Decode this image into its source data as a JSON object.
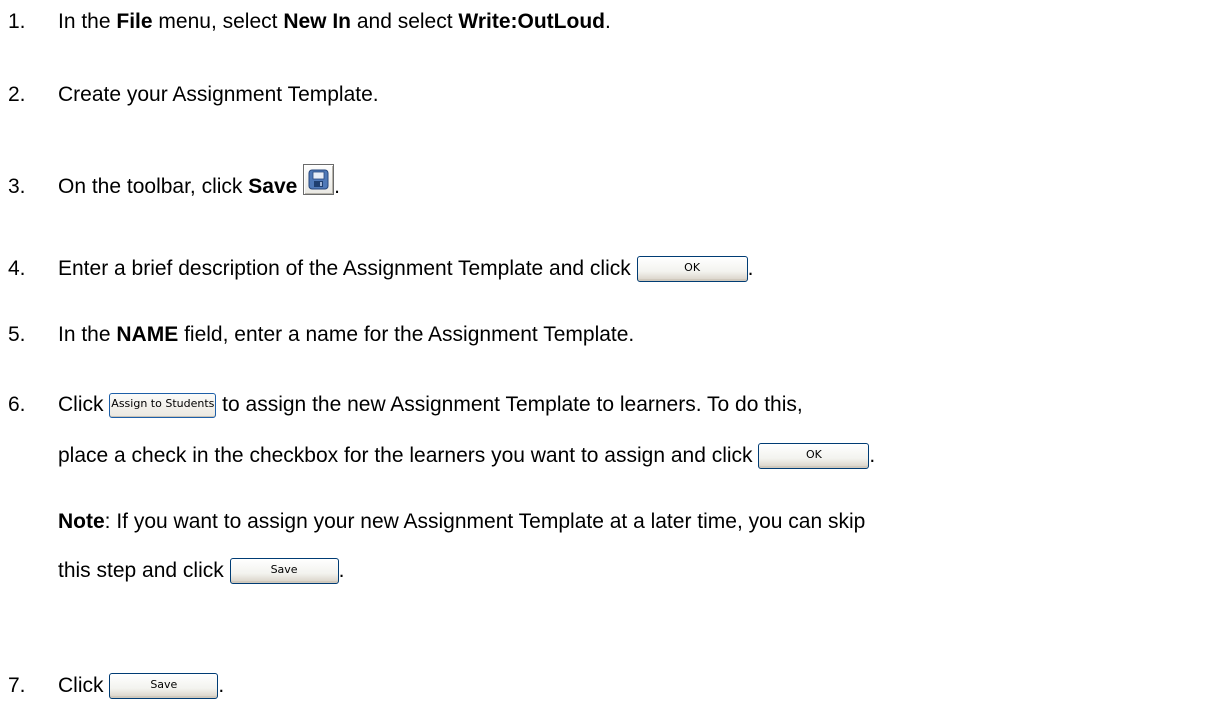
{
  "steps": [
    {
      "number": "1.",
      "parts": [
        "In the ",
        "File",
        " menu, select ",
        "New In",
        " and select ",
        "Write:OutLoud",
        "."
      ]
    },
    {
      "number": "2.",
      "text": "Create your Assignment Template."
    },
    {
      "number": "3.",
      "before": "On the toolbar, click ",
      "bold": "Save",
      "after": "."
    },
    {
      "number": "4.",
      "text": "Enter a brief description of the Assignment Template and click ",
      "button": "OK",
      "after": "."
    },
    {
      "number": "5.",
      "before": "In the ",
      "bold": "NAME",
      "after": " field, enter a name for the Assignment Template."
    },
    {
      "number": "6.",
      "before": "Click ",
      "button": "Assign to Students",
      "after": " to assign the new Assignment Template to learners. To do this,",
      "line2": "place a check in the checkbox for the learners you want to assign and click ",
      "button2": "OK",
      "after2": ".",
      "note_label": "Note",
      "note_text": ": If you want to assign your new Assignment Template at a later time, you can skip",
      "note_line2": "this step and click ",
      "note_button": "Save",
      "note_after": "."
    },
    {
      "number": "7.",
      "before": "Click ",
      "button": "Save",
      "after": "."
    }
  ],
  "icons": {
    "save_toolbar": "floppy-disk-icon"
  }
}
